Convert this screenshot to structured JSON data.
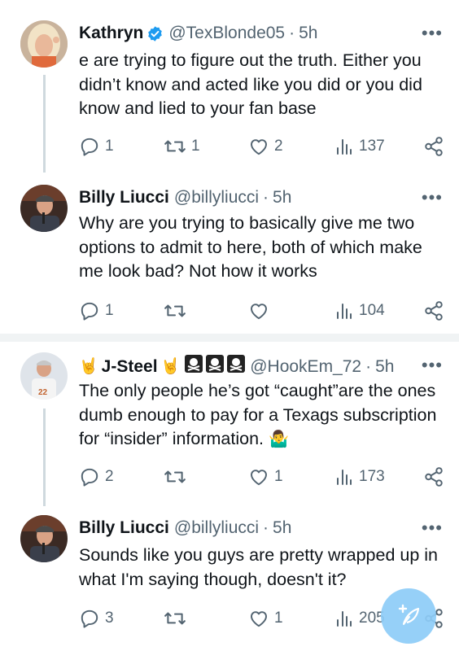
{
  "tweets": [
    {
      "name": "Kathryn",
      "handle": "@TexBlonde05",
      "time": "5h",
      "verified": true,
      "text": "e are trying to figure out the truth.  Either you didn’t know and acted like you did or you did know and lied to your fan base",
      "replies": "1",
      "retweets": "1",
      "likes": "2",
      "views": "137"
    },
    {
      "name": "Billy Liucci",
      "handle": "@billyliucci",
      "time": "5h",
      "text": "Why are you trying to basically give me two options to admit to here, both of which make me look bad? Not how it works",
      "replies": "1",
      "retweets": "",
      "likes": "",
      "views": "104"
    },
    {
      "name": "J-Steel",
      "handle": "@HookEm_72",
      "time": "5h",
      "text": "The only people he’s got “caught”are the ones dumb enough to pay for a Texags subscription for “insider” information.",
      "replies": "2",
      "retweets": "",
      "likes": "1",
      "views": "173"
    },
    {
      "name": "Billy Liucci",
      "handle": "@billyliucci",
      "time": "5h",
      "text": "Sounds like you guys are pretty wrapped up in what I'm saying though, doesn't it?",
      "replies": "3",
      "retweets": "",
      "likes": "1",
      "views": "205"
    }
  ],
  "separator": "·",
  "colors": {
    "accent": "#1d9bf0",
    "muted": "#536471",
    "text": "#0f1419"
  },
  "icons": [
    "reply-icon",
    "retweet-icon",
    "like-icon",
    "views-icon",
    "share-icon",
    "more-icon",
    "verified-icon",
    "compose-icon"
  ]
}
